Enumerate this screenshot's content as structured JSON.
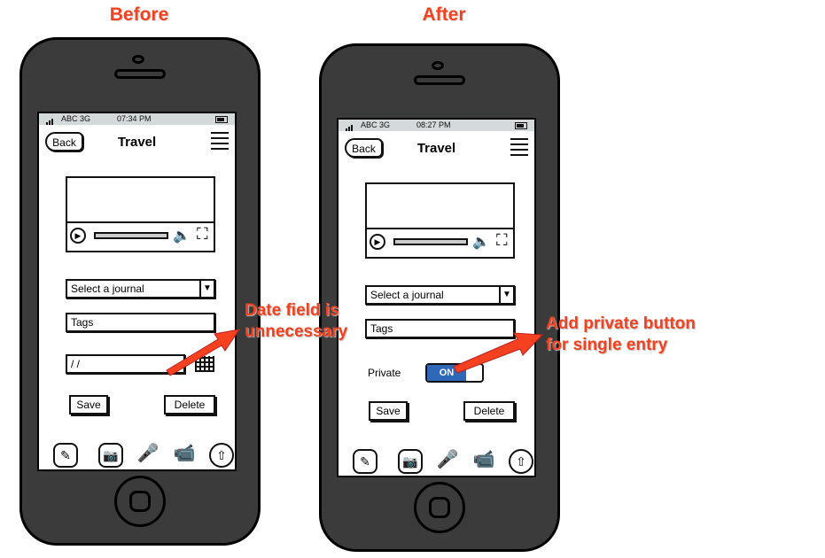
{
  "before": {
    "caption": "Before",
    "status": {
      "carrier": "ABC 3G",
      "time": "07:34 PM"
    },
    "nav": {
      "back_label": "Back",
      "title": "Travel"
    },
    "form": {
      "journal_select": "Select a journal",
      "tags_placeholder": "Tags",
      "date_value": "/ /",
      "save_label": "Save",
      "delete_label": "Delete"
    }
  },
  "after": {
    "caption": "After",
    "status": {
      "carrier": "ABC 3G",
      "time": "08:27 PM"
    },
    "nav": {
      "back_label": "Back",
      "title": "Travel"
    },
    "form": {
      "journal_select": "Select a journal",
      "tags_placeholder": "Tags",
      "private_label": "Private",
      "private_toggle": "ON",
      "save_label": "Save",
      "delete_label": "Delete"
    }
  },
  "annotations": {
    "date_note": [
      "Date field is",
      "unnecessary"
    ],
    "private_note": [
      "Add private button",
      "for single entry"
    ]
  },
  "colors": {
    "annotation": "#f5411f",
    "phone_body": "#3b3b3b",
    "toggle_on": "#2e68b6"
  },
  "icons": {
    "tabbar": [
      "compose-icon",
      "camera-icon",
      "microphone-icon",
      "video-camera-icon",
      "upload-icon"
    ]
  }
}
